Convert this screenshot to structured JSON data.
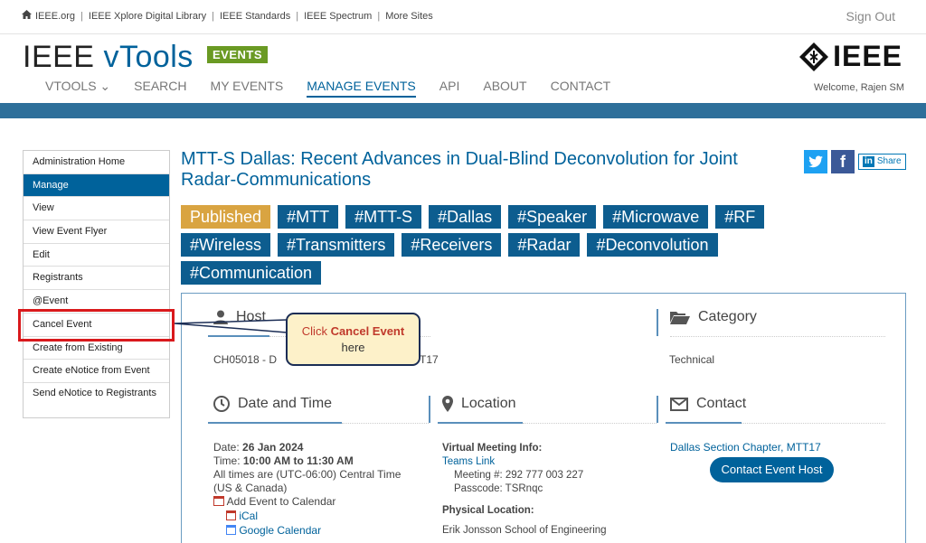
{
  "topbar": {
    "links": [
      "IEEE.org",
      "IEEE Xplore Digital Library",
      "IEEE Standards",
      "IEEE Spectrum",
      "More Sites"
    ],
    "sign_out": "Sign Out"
  },
  "header": {
    "brand_ieee": "IEEE",
    "brand_vtools": "vTools",
    "events_badge": "EVENTS",
    "logo_text": "IEEE",
    "welcome": "Welcome, Rajen SM"
  },
  "nav": [
    "VTOOLS ⌄",
    "SEARCH",
    "MY EVENTS",
    "MANAGE EVENTS",
    "API",
    "ABOUT",
    "CONTACT"
  ],
  "sidebar": {
    "items": [
      "Administration Home",
      "Manage",
      "View",
      "View Event Flyer",
      "Edit",
      "Registrants",
      "@Event",
      "Cancel Event",
      "Create from Existing",
      "Create eNotice from Event",
      "Send eNotice to Registrants"
    ],
    "active_index": 1
  },
  "callout": {
    "prefix": "Click ",
    "bold": "Cancel Event",
    "line2": "here"
  },
  "event": {
    "title": "MTT-S Dallas: Recent Advances in Dual-Blind Deconvolution for Joint Radar-Communications",
    "share_label": "Share",
    "tags": [
      "Published",
      "#MTT",
      "#MTT-S",
      "#Dallas",
      "#Speaker",
      "#Microwave",
      "#RF",
      "#Wireless",
      "#Transmitters",
      "#Receivers",
      "#Radar",
      "#Deconvolution",
      "#Communication"
    ]
  },
  "host": {
    "heading": "Host",
    "value_start": "CH05018 - D",
    "value_end": "T17"
  },
  "category": {
    "heading": "Category",
    "value": "Technical"
  },
  "datetime": {
    "heading": "Date and Time",
    "date_label": "Date:",
    "date_value": "26 Jan 2024",
    "time_label": "Time:",
    "time_value": "10:00 AM to 11:30 AM",
    "tz_note": "All times are (UTC-06:00) Central Time (US & Canada)",
    "add_calendar": "Add Event to Calendar",
    "ical": "iCal",
    "gcal": "Google Calendar"
  },
  "location": {
    "heading": "Location",
    "virtual_label": "Virtual Meeting Info:",
    "teams_link": "Teams Link",
    "meeting_no": "Meeting #: 292 777 003 227",
    "passcode": "Passcode: TSRnqc",
    "physical_label": "Physical Location:",
    "physical_value": "Erik Jonsson School of Engineering"
  },
  "contact": {
    "heading": "Contact",
    "org_link": "Dallas Section Chapter, MTT17",
    "button": "Contact Event Host"
  }
}
